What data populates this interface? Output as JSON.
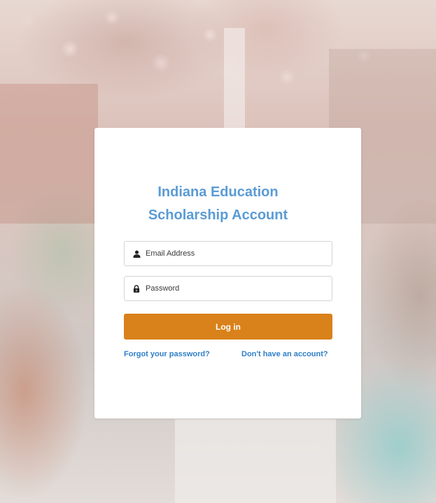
{
  "title": {
    "line1": "Indiana Education",
    "line2": "Scholarship Account"
  },
  "email_field": {
    "placeholder": "Email Address",
    "icon": "user-icon"
  },
  "password_field": {
    "placeholder": "Password",
    "icon": "lock-icon"
  },
  "login_button": {
    "label": "Log in"
  },
  "links": {
    "forgot_password": "Forgot your password?",
    "signup": "Don't have an account?"
  },
  "colors": {
    "title": "#5a9bd5",
    "button": "#d9811a",
    "link": "#2f7fc6"
  }
}
